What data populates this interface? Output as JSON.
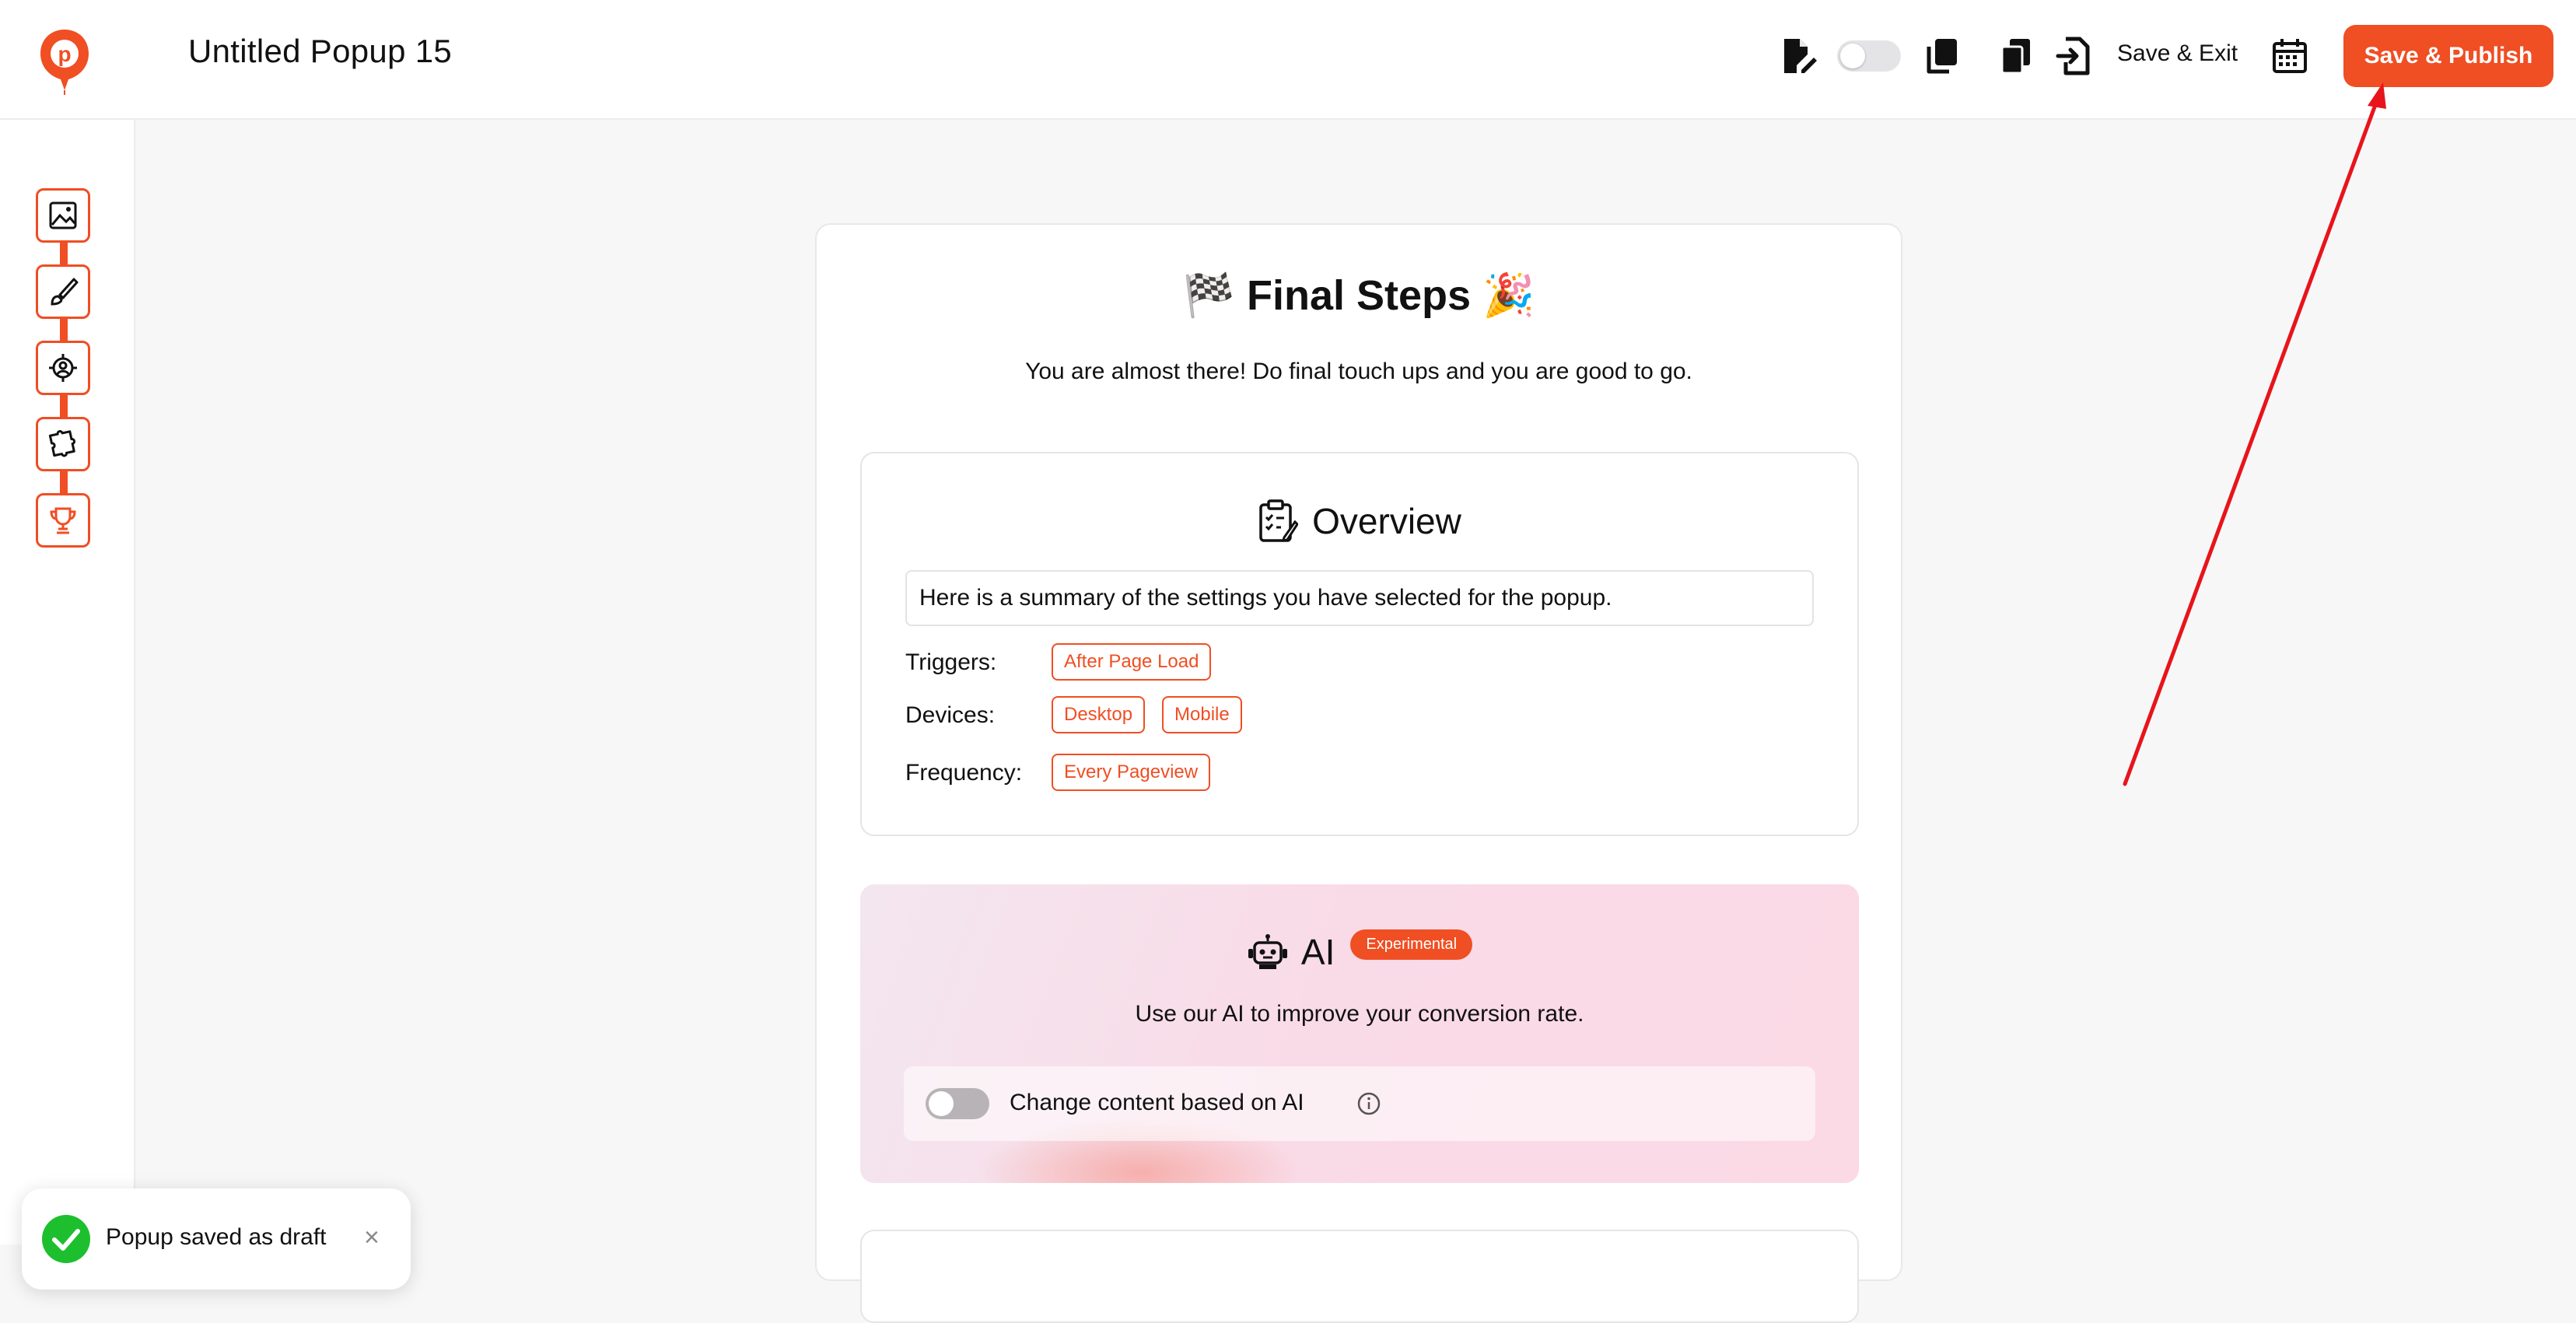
{
  "header": {
    "title": "Untitled Popup 15",
    "save_exit_label": "Save & Exit",
    "publish_label": "Save & Publish",
    "icons": [
      "edit-file-icon",
      "toggle",
      "copy-icon",
      "duplicate-icon",
      "import-icon",
      "calendar-icon"
    ]
  },
  "sidebar": {
    "steps": [
      "image-icon",
      "brush-icon",
      "target-icon",
      "puzzle-icon",
      "trophy-icon"
    ]
  },
  "main": {
    "title": "Final Steps",
    "emoji_left": "🏁",
    "emoji_right": "🎉",
    "subtitle": "You are almost there! Do final touch ups and you are good to go."
  },
  "overview": {
    "title": "Overview",
    "summary": "Here is a summary of the settings you have selected for the popup.",
    "triggers_label": "Triggers:",
    "triggers": [
      "After Page Load"
    ],
    "devices_label": "Devices:",
    "devices": [
      "Desktop",
      "Mobile"
    ],
    "frequency_label": "Frequency:",
    "frequency": [
      "Every Pageview"
    ]
  },
  "ai": {
    "title": "AI",
    "badge": "Experimental",
    "subtitle": "Use our AI to improve your conversion rate.",
    "toggle_label": "Change content based on AI",
    "toggle_on": false
  },
  "toast": {
    "message": "Popup saved as draft",
    "close": "×"
  },
  "colors": {
    "accent": "#f04e23",
    "success": "#1dbf2f",
    "annotation_arrow": "#e8141b"
  }
}
